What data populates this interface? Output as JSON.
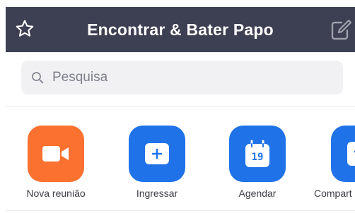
{
  "header": {
    "title": "Encontrar & Bater Papo",
    "background": "#3d3f52",
    "left_icon": "star-icon",
    "right_icon": "edit-icon"
  },
  "search": {
    "placeholder": "Pesquisa",
    "icon": "search-icon"
  },
  "actions": [
    {
      "label": "Nova reunião",
      "icon": "video-camera-icon",
      "color": "#fb7130"
    },
    {
      "label": "Ingressar",
      "icon": "plus-icon",
      "color": "#1f72e8"
    },
    {
      "label": "Agendar",
      "icon": "calendar-icon",
      "color": "#1f72e8",
      "calendar_day": "19"
    },
    {
      "label": "Compart",
      "icon": "share-icon",
      "color": "#1f72e8"
    }
  ]
}
